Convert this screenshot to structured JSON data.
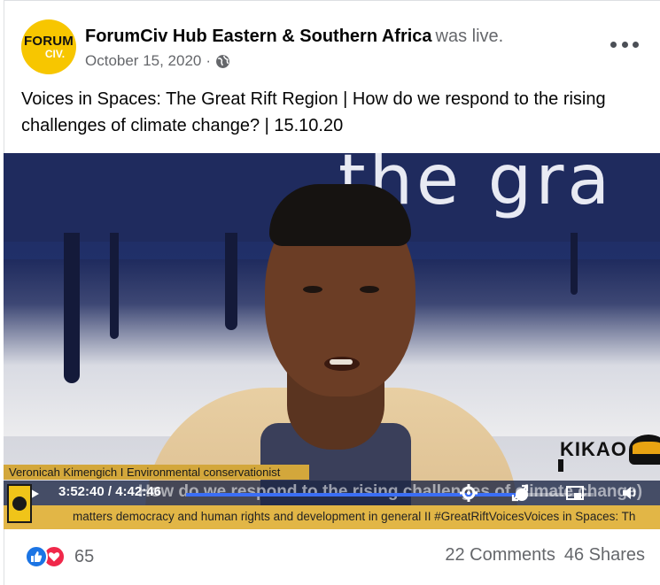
{
  "header": {
    "logo_line1": "FORUM",
    "logo_line2": "CIV.",
    "page_name": "ForumCiv Hub Eastern & Southern Africa",
    "status_suffix": "was live.",
    "date": "October 15, 2020",
    "separator": "·",
    "audience_icon": "globe-icon",
    "more_icon": "more-options-icon"
  },
  "post": {
    "text": "Voices in Spaces: The Great Rift Region | How do we respond to the rising challenges of climate change? | 15.10.20"
  },
  "video": {
    "backdrop_text": "the gra",
    "speaker_caption": "Veronicah Kimengich I Environmental conservationist",
    "time_readout": "3:52:40 / 4:42:46",
    "title_overlay": "How do we respond to the rising challenges of climate change)",
    "progress_fraction": 0.824,
    "ticker_text": "matters democracy and human rights and development in general II #GreatRiftVoicesVoices in Spaces: Th",
    "watermark": "KIKAO",
    "controls": [
      "play-icon",
      "settings-icon",
      "fullscreen-icon",
      "picture-in-picture-icon",
      "volume-icon"
    ]
  },
  "footer": {
    "reaction_count": "65",
    "comments": "22 Comments",
    "shares": "46 Shares"
  },
  "colors": {
    "like": "#1b74e4",
    "love": "#f0284a",
    "secondary_text": "#65676b",
    "logo_yellow": "#f7c600",
    "ticker_gold": "#e2b646"
  }
}
